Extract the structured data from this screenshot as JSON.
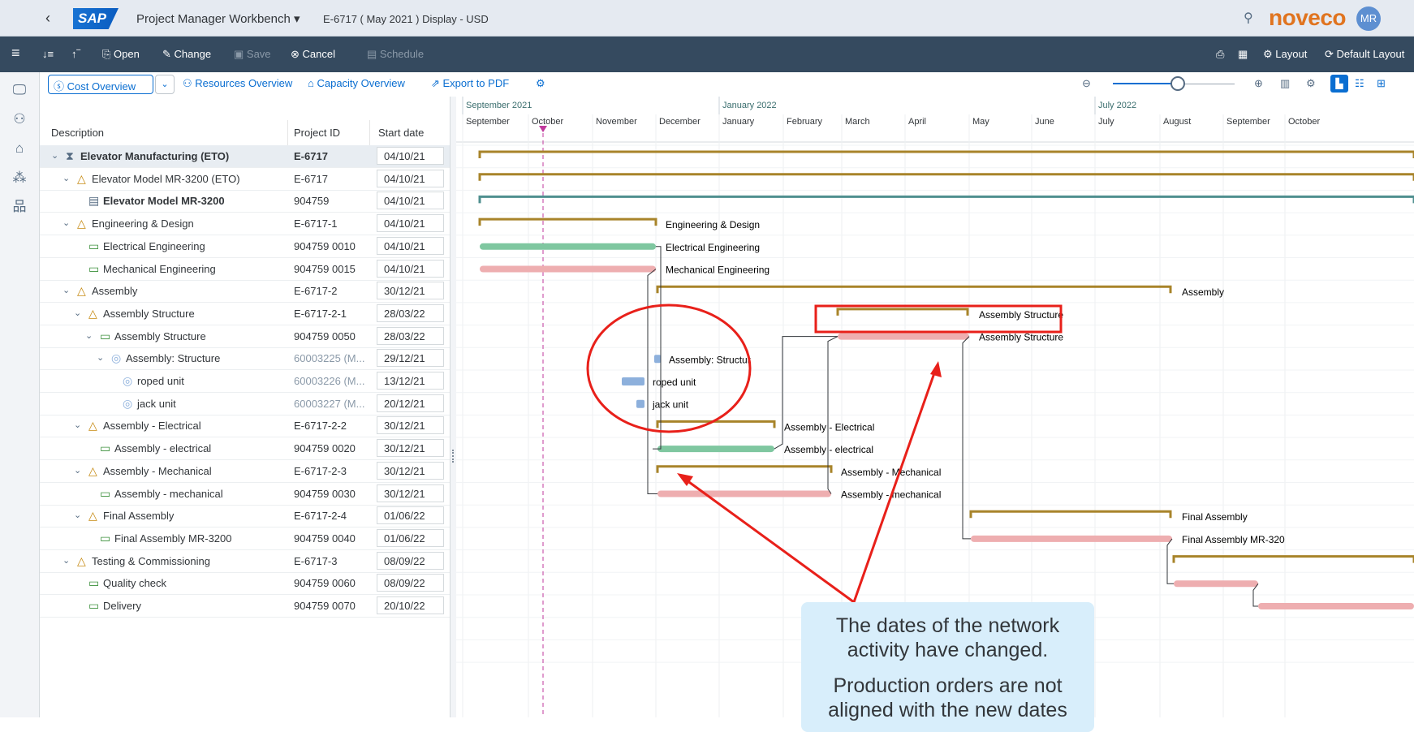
{
  "shell": {
    "back": "‹",
    "logo": "SAP",
    "title": "Project Manager Workbench ▾",
    "subtitle": "E-6717 ( May 2021 ) Display - USD",
    "brand": "noveco",
    "avatar": "MR"
  },
  "toolbar": {
    "menu": "≡",
    "open": "Open",
    "change": "Change",
    "save": "Save",
    "cancel": "Cancel",
    "schedule": "Schedule",
    "layout": "Layout",
    "default_layout": "Default Layout"
  },
  "views": {
    "cost": "Cost Overview",
    "resources": "Resources Overview",
    "capacity": "Capacity Overview",
    "export": "Export to PDF"
  },
  "table": {
    "headers": [
      "Description",
      "Project ID",
      "Start date"
    ],
    "rows": [
      {
        "desc": "Elevator Manufacturing (ETO)",
        "id": "E-6717",
        "date": "04/10/21"
      },
      {
        "desc": "Elevator Model MR-3200 (ETO)",
        "id": "E-6717",
        "date": "04/10/21"
      },
      {
        "desc": "Elevator Model MR-3200",
        "id": "904759",
        "date": "04/10/21"
      },
      {
        "desc": "Engineering & Design",
        "id": "E-6717-1",
        "date": "04/10/21"
      },
      {
        "desc": "Electrical Engineering",
        "id": "904759 0010",
        "date": "04/10/21"
      },
      {
        "desc": "Mechanical Engineering",
        "id": "904759 0015",
        "date": "04/10/21"
      },
      {
        "desc": "Assembly",
        "id": "E-6717-2",
        "date": "30/12/21"
      },
      {
        "desc": "Assembly Structure",
        "id": "E-6717-2-1",
        "date": "28/03/22"
      },
      {
        "desc": "Assembly Structure",
        "id": "904759 0050",
        "date": "28/03/22"
      },
      {
        "desc": "Assembly: Structure",
        "id": "60003225 (M...",
        "date": "29/12/21"
      },
      {
        "desc": "roped unit",
        "id": "60003226 (M...",
        "date": "13/12/21"
      },
      {
        "desc": "jack unit",
        "id": "60003227 (M...",
        "date": "20/12/21"
      },
      {
        "desc": "Assembly - Electrical",
        "id": "E-6717-2-2",
        "date": "30/12/21"
      },
      {
        "desc": "Assembly - electrical",
        "id": "904759 0020",
        "date": "30/12/21"
      },
      {
        "desc": "Assembly - Mechanical",
        "id": "E-6717-2-3",
        "date": "30/12/21"
      },
      {
        "desc": "Assembly - mechanical",
        "id": "904759 0030",
        "date": "30/12/21"
      },
      {
        "desc": "Final Assembly",
        "id": "E-6717-2-4",
        "date": "01/06/22"
      },
      {
        "desc": "Final Assembly MR-3200",
        "id": "904759 0040",
        "date": "01/06/22"
      },
      {
        "desc": "Testing & Commissioning",
        "id": "E-6717-3",
        "date": "08/09/22"
      },
      {
        "desc": "Quality check",
        "id": "904759 0060",
        "date": "08/09/22"
      },
      {
        "desc": "Delivery",
        "id": "904759 0070",
        "date": "20/10/22"
      }
    ]
  },
  "gantt": {
    "years": [
      "September 2021",
      "January 2022",
      "July 2022"
    ],
    "months": [
      "September",
      "October",
      "November",
      "December",
      "January",
      "February",
      "March",
      "April",
      "May",
      "June",
      "July",
      "August",
      "September",
      "October"
    ],
    "labels": {
      "eng": "Engineering & Design",
      "elec": "Electrical Engineering",
      "mech": "Mechanical Engineering",
      "assembly": "Assembly",
      "as_struct_sum": "Assembly Structure",
      "as_struct_act": "Assembly Structure",
      "as_struct_po": "Assembly: Structur",
      "roped": "roped unit",
      "jack": "jack unit",
      "as_elec_sum": "Assembly - Electrical",
      "as_elec_act": "Assembly - electrical",
      "as_mech_sum": "Assembly - Mechanical",
      "as_mech_act": "Assembly - mechanical",
      "final_sum": "Final Assembly",
      "final_act": "Final Assembly MR-320"
    }
  },
  "callout": {
    "line1": "The dates of the network activity have changed.",
    "line2": "Production orders are not aligned with the new dates"
  },
  "colors": {
    "summary": "#a8842a",
    "teal": "#4f8f8f",
    "green": "#7fc7a0",
    "pink": "#eeaeb0",
    "blue": "#8db0dc",
    "red": "#e8201a"
  }
}
